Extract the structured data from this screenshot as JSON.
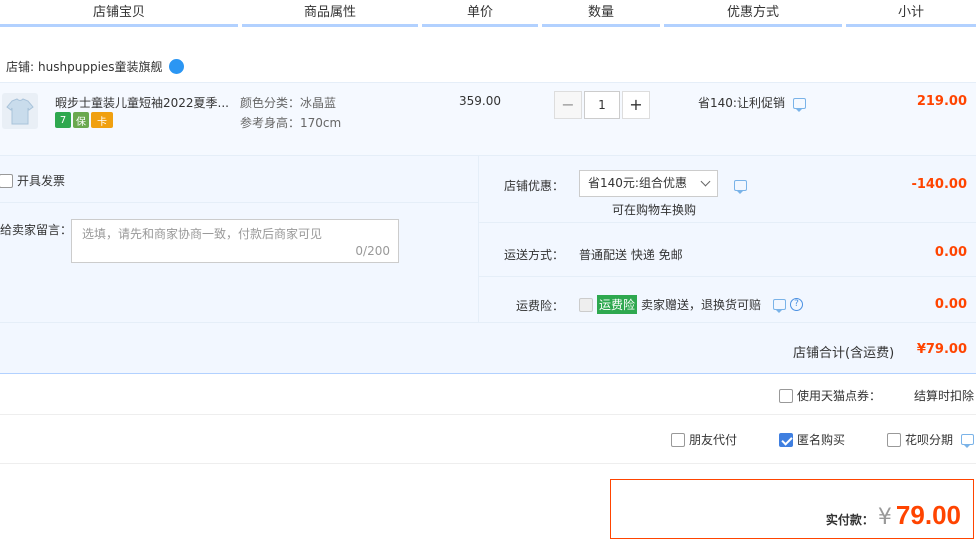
{
  "header": {
    "columns": [
      "店铺宝贝",
      "商品属性",
      "单价",
      "数量",
      "优惠方式",
      "小计"
    ]
  },
  "shop": {
    "label": "店铺:",
    "name": "hushpuppies童装旗舰"
  },
  "item": {
    "title": "暇步士童装儿童短袖2022夏季...",
    "attr_color": "颜色分类：冰晶蓝",
    "attr_height": "参考身高：170cm",
    "price": "359.00",
    "quantity": "1",
    "minus": "−",
    "plus": "+",
    "promo": "省140:让利促销",
    "subtotal": "219.00",
    "badges": [
      "7",
      "保",
      "卡"
    ],
    "badge_colors": [
      "#2ea84f",
      "#6aa84f",
      "#f0a010"
    ]
  },
  "extras": {
    "invoice_label": "开具发票",
    "message_label": "给卖家留言：",
    "message_placeholder": "选填，请先和商家协商一致，付款后商家可见",
    "message_count": "0/200",
    "discount_label": "店铺优惠：",
    "discount_value": "省140元:组合优惠",
    "discount_note": "可在购物车换购",
    "discount_amount": "-140.00",
    "shipping_label": "运送方式：",
    "shipping_value": "普通配送 快递 免邮",
    "shipping_amount": "0.00",
    "insurance_label": "运费险：",
    "insurance_tag": "运费险",
    "insurance_text": "卖家赠送，退换货可赔",
    "insurance_amount": "0.00",
    "shop_total_label": "店铺合计(含运费)",
    "shop_total": "¥79.00"
  },
  "options": {
    "tmall_points": "使用天猫点券：",
    "settle_note": "结算时扣除",
    "friend_pay": "朋友代付",
    "anonymous": "匿名购买",
    "huabei": "花呗分期"
  },
  "payment": {
    "label": "实付款：",
    "currency": "¥",
    "amount": "79.00"
  },
  "colors": {
    "accent": "#ff4400",
    "header_rule": "#b2d1ff",
    "panel_bg": "#f2f7ff",
    "checkbox_checked": "#3f7fe0"
  }
}
